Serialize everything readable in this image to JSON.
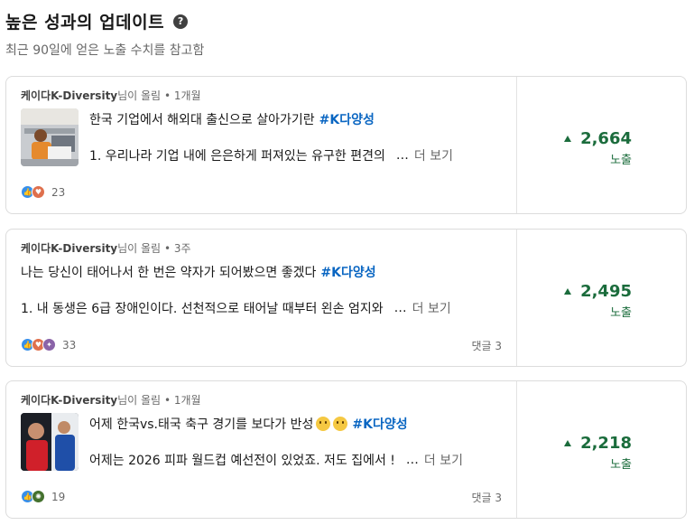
{
  "header": {
    "title": "높은 성과의 업데이트",
    "subtitle": "최근 90일에 얻은 노출 수치를 참고함",
    "help_icon": "question-circle-icon"
  },
  "colors": {
    "accent_green": "#1b6c3c",
    "hashtag_blue": "#0a66c2"
  },
  "posts": [
    {
      "author": "케이다K-Diversity",
      "posted": "님이 올림",
      "time": "• 1개월",
      "title": "한국 기업에서 해외대 출신으로 살아가기란",
      "hashtag": "#K다양성",
      "excerpt": "1. 우리나라 기업 내에 은은하게 퍼져있는 유구한 편견의",
      "ellipsis": "…",
      "more": "더 보기",
      "reactions_count": "23",
      "comments": "",
      "impressions": "2,664",
      "impressions_label": "노출"
    },
    {
      "author": "케이다K-Diversity",
      "posted": "님이 올림",
      "time": "• 3주",
      "title": "나는 당신이 태어나서 한 번은 약자가 되어봤으면 좋겠다",
      "hashtag": "#K다양성",
      "excerpt": "1. 내 동생은 6급 장애인이다. 선천적으로 태어날 때부터 왼손 엄지와",
      "ellipsis": "…",
      "more": "더 보기",
      "reactions_count": "33",
      "comments": "댓글 3",
      "impressions": "2,495",
      "impressions_label": "노출"
    },
    {
      "author": "케이다K-Diversity",
      "posted": "님이 올림",
      "time": "• 1개월",
      "title": "어제 한국vs.태국 축구 경기를 보다가 반성",
      "hashtag": "#K다양성",
      "excerpt": "어제는 2026 피파 월드컵 예선전이 있었죠. 저도 집에서 !",
      "ellipsis": "…",
      "more": "더 보기",
      "reactions_count": "19",
      "comments": "댓글 3",
      "impressions": "2,218",
      "impressions_label": "노출"
    }
  ]
}
